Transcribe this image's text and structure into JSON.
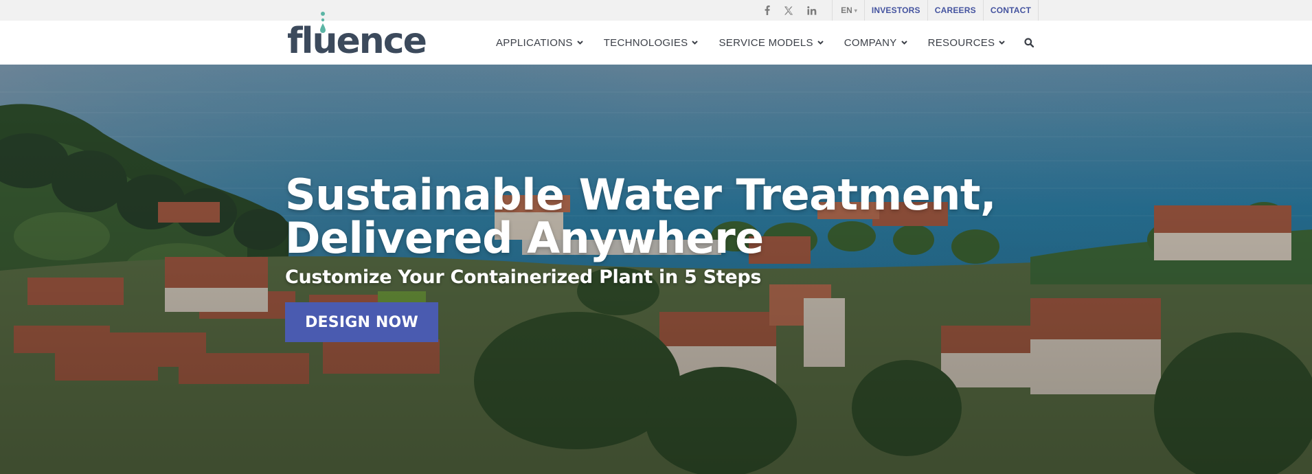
{
  "topbar": {
    "social": [
      {
        "name": "facebook-icon",
        "glyph": "f"
      },
      {
        "name": "x-twitter-icon",
        "glyph": "X"
      },
      {
        "name": "linkedin-icon",
        "glyph": "in"
      }
    ],
    "language": "EN",
    "links": [
      "INVESTORS",
      "CAREERS",
      "CONTACT"
    ]
  },
  "header": {
    "logo_text": "fluence",
    "nav": [
      {
        "label": "APPLICATIONS"
      },
      {
        "label": "TECHNOLOGIES"
      },
      {
        "label": "SERVICE MODELS"
      },
      {
        "label": "COMPANY"
      },
      {
        "label": "RESOURCES"
      }
    ],
    "search_icon": "search-icon"
  },
  "hero": {
    "title_line1": "Sustainable Water Treatment,",
    "title_line2": "Delivered Anywhere",
    "subtitle": "Customize Your Containerized Plant in 5 Steps",
    "cta_label": "DESIGN NOW"
  },
  "colors": {
    "brand_blue": "#44539f",
    "cta_blue": "#4a5bb0",
    "logo_gray": "#3c4a5c",
    "logo_teal": "#5bb5a5",
    "topbar_bg": "#f1f1f1"
  }
}
